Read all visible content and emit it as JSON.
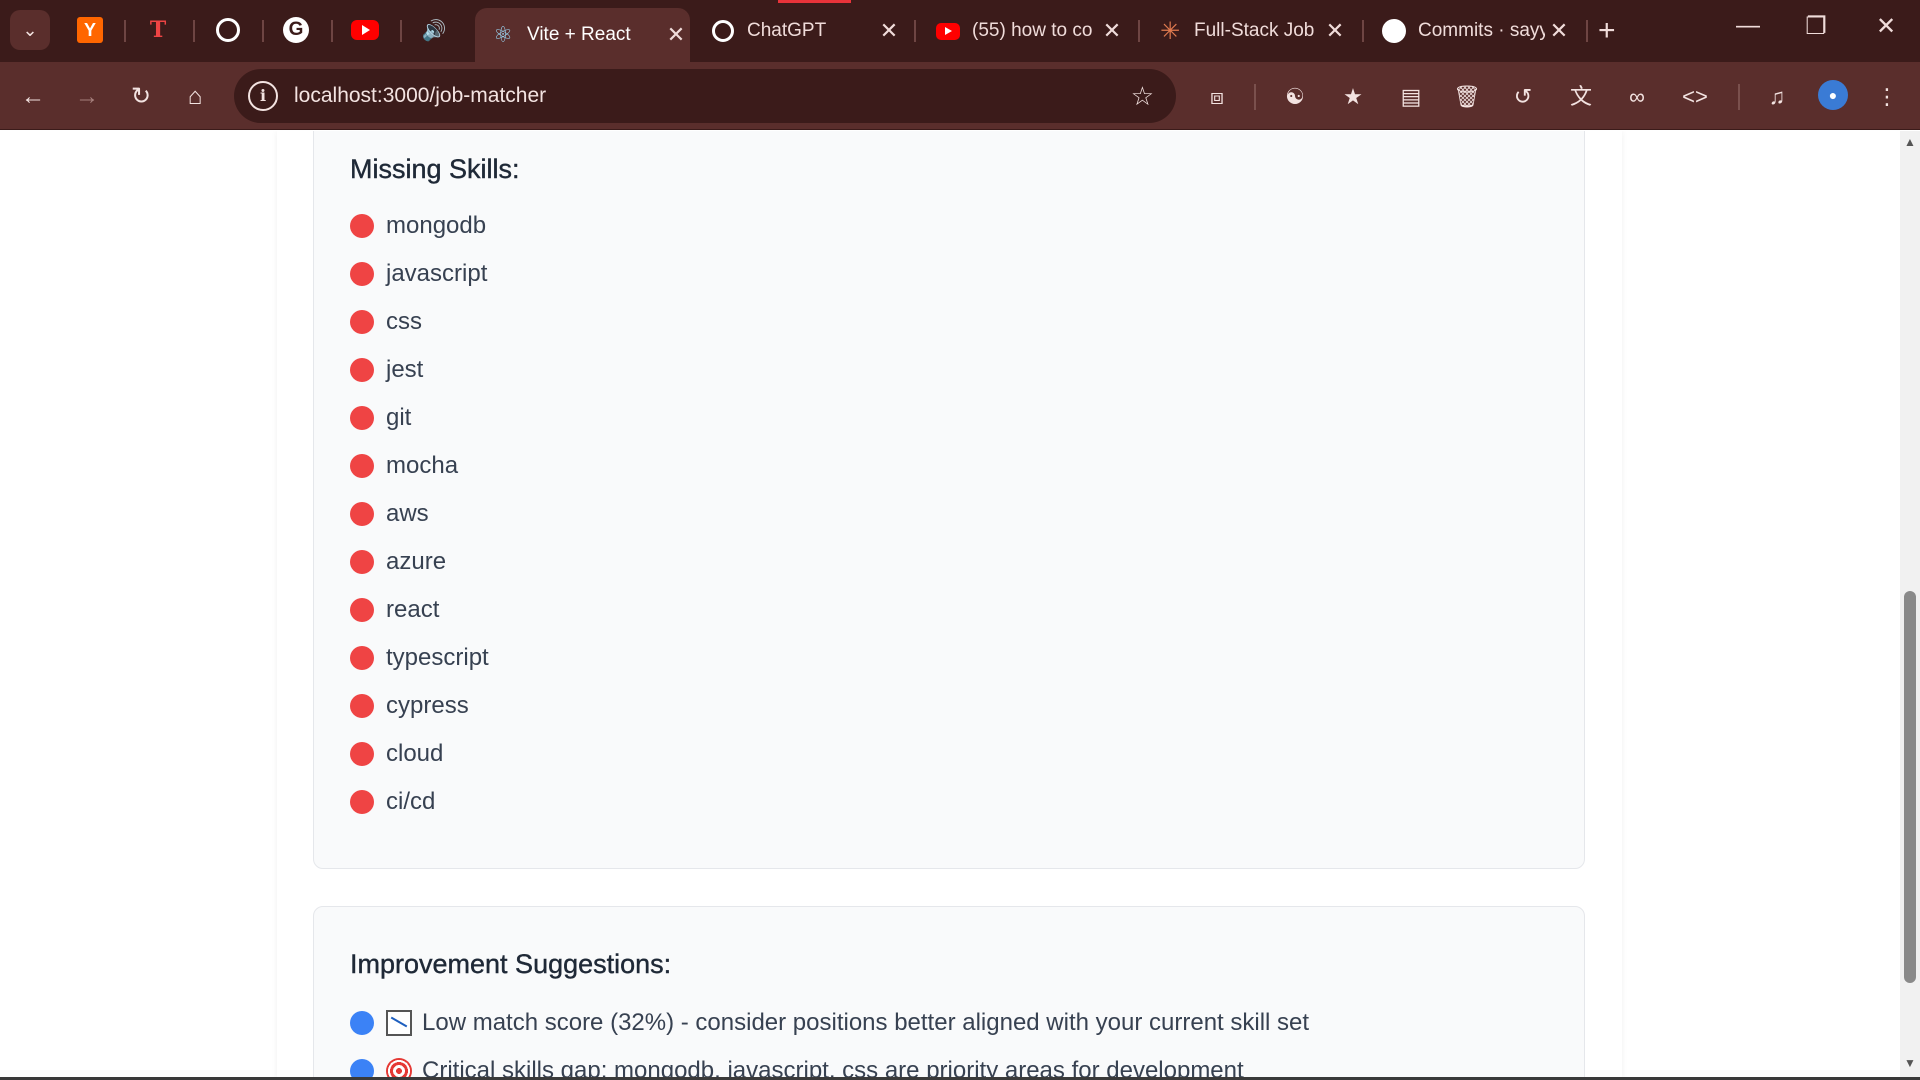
{
  "browser": {
    "tabs": [
      {
        "title": "Vite + React",
        "icon": "react-icon",
        "active": true
      },
      {
        "title": "ChatGPT",
        "icon": "chatgpt-icon",
        "active": false
      },
      {
        "title": "(55) how to co",
        "icon": "youtube-icon",
        "active": false
      },
      {
        "title": "Full-Stack Job",
        "icon": "claude-icon",
        "active": false
      },
      {
        "title": "Commits · sayy",
        "icon": "github-icon",
        "active": false
      }
    ],
    "pinned_tabs": [
      "y-icon",
      "t-icon",
      "chatgpt-icon",
      "google-icon",
      "youtube-icon",
      "sound-icon"
    ],
    "url": "localhost:3000/job-matcher",
    "accent_color": "#5a2e2c",
    "frame_color": "#3b1b1a"
  },
  "missing_skills": {
    "heading": "Missing Skills:",
    "items": [
      "mongodb",
      "javascript",
      "css",
      "jest",
      "git",
      "mocha",
      "aws",
      "azure",
      "react",
      "typescript",
      "cypress",
      "cloud",
      "ci/cd"
    ],
    "bullet_color": "#ef4444"
  },
  "suggestions": {
    "heading": "Improvement Suggestions:",
    "items": [
      {
        "icon": "chart-decreasing-icon",
        "text": "Low match score (32%) - consider positions better aligned with your current skill set"
      },
      {
        "icon": "target-icon",
        "text": "Critical skills gap: mongodb, javascript, css are priority areas for development"
      }
    ],
    "bullet_color": "#3b82f6"
  }
}
